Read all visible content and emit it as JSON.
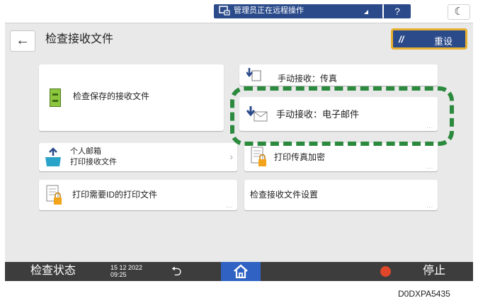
{
  "status_bar": {
    "remote_text": "管理员正在远程操作",
    "help_label": "?",
    "energy_label": "☾"
  },
  "header": {
    "back_label": "←",
    "title": "检查接收文件",
    "reset_label": "重设"
  },
  "tiles": {
    "check_saved": "检查保存的接收文件",
    "manual_fax": "手动接收：传真",
    "manual_email": "手动接收：电子邮件",
    "personal_box_line1": "个人邮箱",
    "personal_box_line2": "打印接收文件",
    "print_fax_encrypted": "打印传真加密",
    "print_id_files": "打印需要ID的打印文件",
    "check_settings": "检查接收文件设置"
  },
  "more_glyph": "...",
  "bottom_bar": {
    "status_label": "检查状态",
    "date": "15 12 2022",
    "time": "09:25",
    "stop_label": "停止"
  },
  "image_code": "D0DXPA5435",
  "colors": {
    "accent_blue": "#2a4a8a",
    "home_blue": "#2f62c3",
    "highlight_green": "#2b8a3e",
    "reset_border": "#e8b030",
    "stop_red": "#e0472a"
  }
}
